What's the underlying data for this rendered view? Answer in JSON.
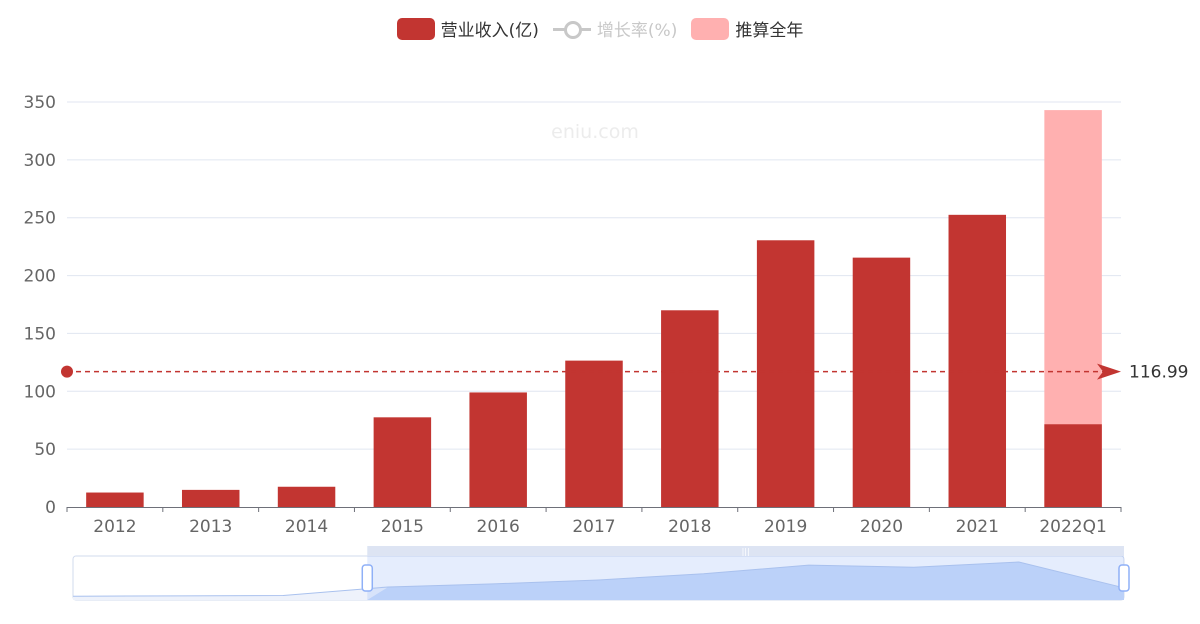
{
  "legend": {
    "revenue": "营业收入(亿)",
    "growth": "增长率(%)",
    "estimate": "推算全年"
  },
  "watermark": "eniu.com",
  "colors": {
    "revenue": "#c23531",
    "estimate": "#ffb0b0",
    "grid": "#e0e6f1",
    "growth_off": "#c8c8c8"
  },
  "chart_data": {
    "type": "bar",
    "categories": [
      "2012",
      "2013",
      "2014",
      "2015",
      "2016",
      "2017",
      "2018",
      "2019",
      "2020",
      "2021",
      "2022Q1"
    ],
    "series": [
      {
        "name": "营业收入(亿)",
        "values": [
          12.5,
          14.8,
          17.5,
          77.5,
          99,
          126.5,
          170,
          230.5,
          215.5,
          252.5,
          71.5
        ]
      },
      {
        "name": "推算全年",
        "values": [
          null,
          null,
          null,
          null,
          null,
          null,
          null,
          null,
          null,
          null,
          343
        ]
      }
    ],
    "average_line": {
      "value": 116.99,
      "label": "116.99"
    },
    "ylim": [
      0,
      350
    ],
    "yticks": [
      0,
      50,
      100,
      150,
      200,
      250,
      300,
      350
    ],
    "grid": true,
    "legend_position": "top-center",
    "datazoom": {
      "start_fraction": 0.28,
      "end_fraction": 1.0
    }
  }
}
